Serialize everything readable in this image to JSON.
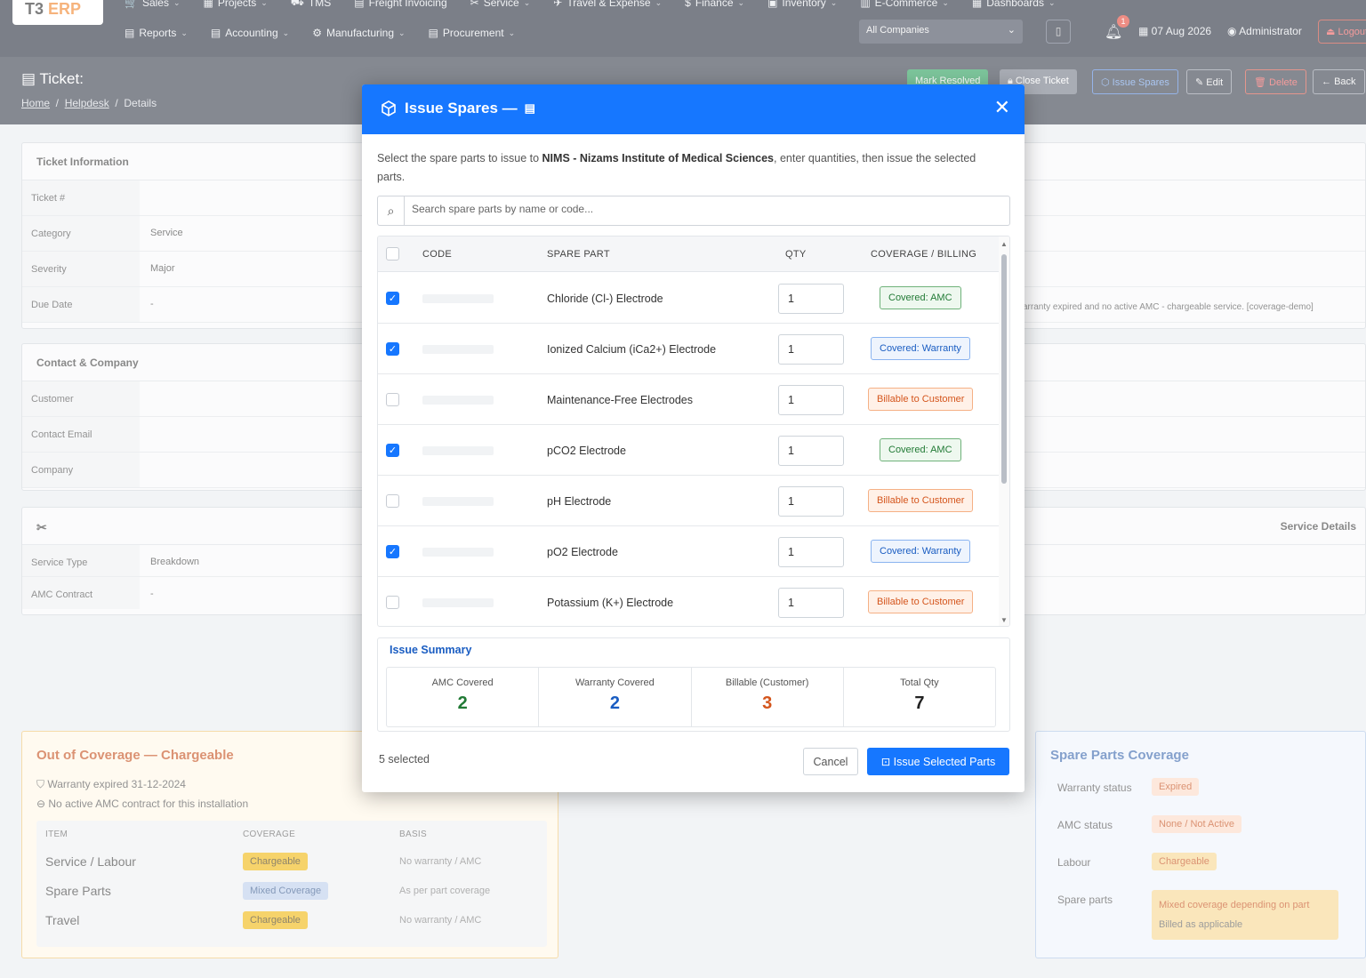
{
  "app": {
    "logo_main": "T3",
    "logo_accent": "ERP"
  },
  "nav": {
    "row1": [
      "Sales",
      "Projects",
      "TMS",
      "Freight Invoicing",
      "Service",
      "Travel & Expense",
      "Finance",
      "Inventory",
      "E-Commerce",
      "Dashboards"
    ],
    "row2": [
      "Reports",
      "Accounting",
      "Manufacturing",
      "Procurement"
    ],
    "company_select": "All Companies",
    "notification_count": "1",
    "date": "07 Aug 2026",
    "user": "Administrator",
    "logout": "Logout"
  },
  "page": {
    "title": "Ticket:",
    "breadcrumb": [
      "Home",
      "Helpdesk",
      "Details"
    ],
    "actions": {
      "mark_resolved": "Mark Resolved",
      "close_ticket": "Close Ticket",
      "issue_spares": "Issue Spares",
      "edit": "Edit",
      "delete": "Delete",
      "back": "Back"
    }
  },
  "ticket_info": {
    "header": "Ticket Information",
    "rows": [
      {
        "k": "Ticket #",
        "v": ""
      },
      {
        "k": "Category",
        "v": "Service"
      },
      {
        "k": "Severity",
        "v": "Major"
      },
      {
        "k": "Due Date",
        "v": "-"
      }
    ],
    "note": "arranty expired and no active AMC - chargeable service. [coverage-demo]"
  },
  "contact": {
    "header": "Contact & Company",
    "rows": [
      {
        "k": "Customer",
        "v": ""
      },
      {
        "k": "Contact Email",
        "v": ""
      },
      {
        "k": "Company",
        "v": ""
      }
    ]
  },
  "service": {
    "header_right": "Service Details",
    "rows": [
      {
        "k": "Service Type",
        "v": "Breakdown"
      },
      {
        "k": "AMC Contract",
        "v": "-"
      }
    ]
  },
  "out_of_coverage": {
    "title": "Out of Coverage — Chargeable",
    "line1": "Warranty expired 31-12-2024",
    "line2": "No active AMC contract for this installation",
    "headers": [
      "ITEM",
      "COVERAGE",
      "BASIS"
    ],
    "rows": [
      {
        "item": "Service / Labour",
        "coverage": "Chargeable",
        "basis": "No warranty / AMC"
      },
      {
        "item": "Spare Parts",
        "coverage": "Mixed Coverage",
        "basis": "As per part coverage"
      },
      {
        "item": "Travel",
        "coverage": "Chargeable",
        "basis": "No warranty / AMC"
      }
    ]
  },
  "spare_parts_coverage": {
    "title": "Spare Parts Coverage",
    "rows": [
      {
        "k": "Warranty status",
        "v": "Expired"
      },
      {
        "k": "AMC status",
        "v": "None / Not Active"
      },
      {
        "k": "Labour",
        "v": "Chargeable"
      },
      {
        "k": "Spare parts",
        "v": "Mixed coverage depending on part",
        "v2": "Billed as applicable"
      }
    ]
  },
  "modal": {
    "title": "Issue Spares —",
    "description_pre": "Select the spare parts to issue to ",
    "description_customer": "NIMS - Nizams Institute of Medical Sciences",
    "description_post": ", enter quantities, then issue the selected parts.",
    "search_placeholder": "Search spare parts by name or code...",
    "columns": {
      "code": "CODE",
      "part": "SPARE PART",
      "qty": "QTY",
      "coverage": "COVERAGE / BILLING"
    },
    "parts": [
      {
        "name": "Chloride (Cl-) Electrode",
        "qty": "1",
        "coverage": "Covered: AMC",
        "checked": true
      },
      {
        "name": "Ionized Calcium (iCa2+) Electrode",
        "qty": "1",
        "coverage": "Covered: Warranty",
        "checked": true
      },
      {
        "name": "Maintenance-Free Electrodes",
        "qty": "1",
        "coverage": "Billable to Customer",
        "checked": false
      },
      {
        "name": "pCO2 Electrode",
        "qty": "1",
        "coverage": "Covered: AMC",
        "checked": true
      },
      {
        "name": "pH Electrode",
        "qty": "1",
        "coverage": "Billable to Customer",
        "checked": false
      },
      {
        "name": "pO2 Electrode",
        "qty": "1",
        "coverage": "Covered: Warranty",
        "checked": true
      },
      {
        "name": "Potassium (K+) Electrode",
        "qty": "1",
        "coverage": "Billable to Customer",
        "checked": false
      }
    ],
    "summary": {
      "title": "Issue Summary",
      "amc_label": "AMC Covered",
      "amc_value": "2",
      "warranty_label": "Warranty Covered",
      "warranty_value": "2",
      "billable_label": "Billable (Customer)",
      "billable_value": "3",
      "total_label": "Total Qty",
      "total_value": "7"
    },
    "selected_text": "5 selected",
    "cancel": "Cancel",
    "issue_button": "Issue Selected Parts"
  },
  "colors": {
    "primary": "#1677ff",
    "amc_green": "#217a35",
    "billable_orange": "#d4551c",
    "nav_bg": "#1c2333"
  }
}
